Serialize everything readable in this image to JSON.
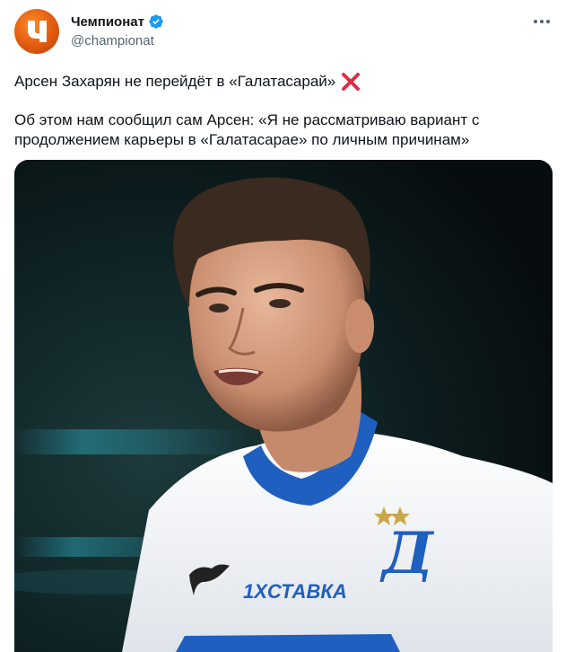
{
  "account": {
    "display_name": "Чемпионат",
    "handle": "@championat",
    "verified": true,
    "avatar_icon": "championat-logo",
    "avatar_color": "#e8681a"
  },
  "tweet": {
    "headline": "Арсен Захарян не перейдёт в «Галатасарай»",
    "headline_emoji": "cross-mark-icon",
    "body": "Об этом нам сообщил сам Арсен: «Я не рассматриваю вариант с продолжением карьеры в «Галатасарае» по личным причинам»"
  },
  "media": {
    "kind": "photo",
    "subject": "football player in white Dynamo kit",
    "jersey_sponsor": "1XСТАВКА",
    "colors": {
      "jersey": "#f2f4f7",
      "collar": "#1f5fbf",
      "background": "#0b1416"
    }
  },
  "colors": {
    "verified_badge": "#1d9bf0",
    "text_primary": "#0f1419",
    "text_secondary": "#536471",
    "cross_mark": "#dd2e44"
  }
}
